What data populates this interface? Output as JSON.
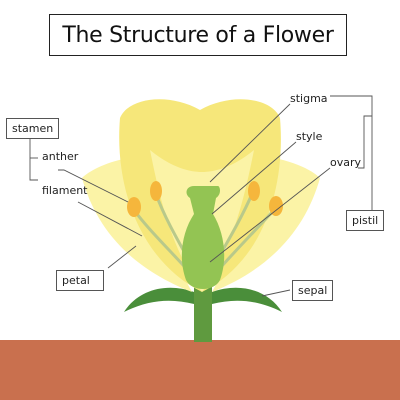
{
  "title": "The Structure of a Flower",
  "labels": {
    "stamen": "stamen",
    "anther": "anther",
    "filament": "filament",
    "petal": "petal",
    "stigma": "stigma",
    "style": "style",
    "ovary": "ovary",
    "pistil": "pistil",
    "sepal": "sepal"
  },
  "colors": {
    "petal_light": "#fbf3a6",
    "petal_mid": "#f6e77a",
    "pistil": "#93c453",
    "stem": "#5f9a3f",
    "sepal": "#4a8e3a",
    "anther": "#f5b63c",
    "filament": "#b9c98a",
    "ground": "#c9704e",
    "line": "#555555"
  }
}
